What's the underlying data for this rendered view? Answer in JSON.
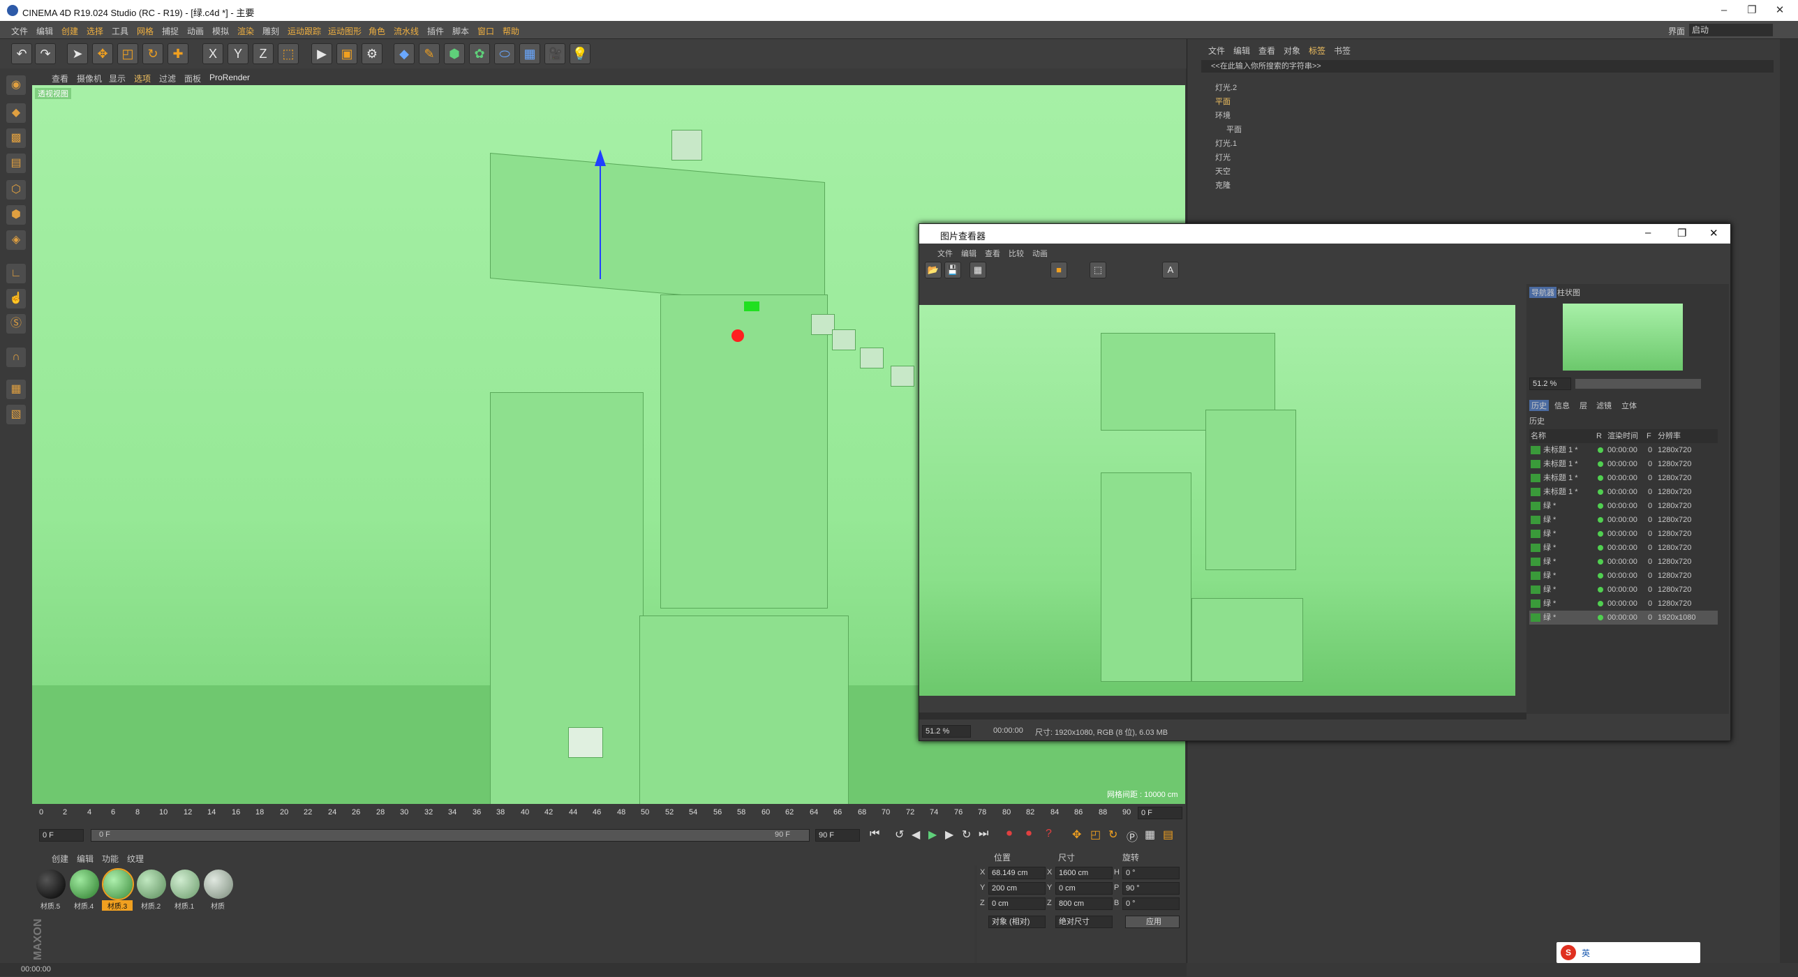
{
  "app": {
    "title": "CINEMA 4D R19.024 Studio (RC - R19) - [绿.c4d *] - 主要",
    "layout_label": "界面",
    "layout_value": "启动"
  },
  "menu": [
    "文件",
    "编辑",
    "创建",
    "选择",
    "工具",
    "网格",
    "捕捉",
    "动画",
    "模拟",
    "渲染",
    "雕刻",
    "运动跟踪",
    "运动图形",
    "角色",
    "流水线",
    "插件",
    "脚本",
    "窗口",
    "帮助"
  ],
  "toolbar": {
    "icons": [
      "undo",
      "redo",
      "select",
      "move",
      "scale",
      "rotate",
      "add",
      "x-axis",
      "y-axis",
      "z-axis",
      "coords",
      "render-view",
      "render",
      "render-settings",
      "cube",
      "pen",
      "subdiv",
      "array",
      "deformer",
      "scene",
      "camera",
      "light"
    ],
    "axis_x": "X",
    "axis_y": "Y",
    "axis_z": "Z"
  },
  "viewport": {
    "menu": [
      "查看",
      "摄像机",
      "显示",
      "选项",
      "过滤",
      "面板",
      "ProRender"
    ],
    "label": "透视视图",
    "grid_info": "网格间距 : 10000 cm"
  },
  "timeline": {
    "ticks": [
      "0",
      "2",
      "4",
      "6",
      "8",
      "10",
      "12",
      "14",
      "16",
      "18",
      "20",
      "22",
      "24",
      "26",
      "28",
      "30",
      "32",
      "34",
      "36",
      "38",
      "40",
      "42",
      "44",
      "46",
      "48",
      "50",
      "52",
      "54",
      "56",
      "58",
      "60",
      "62",
      "64",
      "66",
      "68",
      "70",
      "72",
      "74",
      "76",
      "78",
      "80",
      "82",
      "84",
      "86",
      "88",
      "90"
    ],
    "current_frame": "0 F",
    "start": "0 F",
    "end": "90 F",
    "range_end": "90 F",
    "frame_field": "0 F"
  },
  "materials": {
    "menu": [
      "创建",
      "编辑",
      "功能",
      "纹理"
    ],
    "items": [
      {
        "name": "材质.5",
        "color": "#111111"
      },
      {
        "name": "材质.4",
        "color": "#4aa84a"
      },
      {
        "name": "材质.3",
        "color": "#5cbc5c"
      },
      {
        "name": "材质.2",
        "color": "#7ab87a"
      },
      {
        "name": "材质.1",
        "color": "#8aba8a"
      },
      {
        "name": "材质",
        "color": "#9aa89a"
      }
    ]
  },
  "coords": {
    "headers": [
      "位置",
      "尺寸",
      "旋转"
    ],
    "rows": [
      {
        "axis": "X",
        "pos": "68.149 cm",
        "size_axis": "X",
        "size": "1600 cm",
        "rot_axis": "H",
        "rot": "0 °"
      },
      {
        "axis": "Y",
        "pos": "200 cm",
        "size_axis": "Y",
        "size": "0 cm",
        "rot_axis": "P",
        "rot": "90 °"
      },
      {
        "axis": "Z",
        "pos": "0 cm",
        "size_axis": "Z",
        "size": "800 cm",
        "rot_axis": "B",
        "rot": "0 °"
      }
    ],
    "mode1": "对象 (相对)",
    "mode2": "绝对尺寸",
    "apply": "应用"
  },
  "status": {
    "time": "00:00:00"
  },
  "objmgr": {
    "menu": [
      "文件",
      "编辑",
      "查看",
      "对象",
      "标签",
      "书签"
    ],
    "search": "<<在此输入你所搜索的字符串>>",
    "objects": [
      "灯光.2",
      "平面",
      "环境",
      "平面",
      "灯光.1",
      "灯光",
      "天空",
      "克隆"
    ]
  },
  "picviewer": {
    "title": "图片查看器",
    "menu": [
      "文件",
      "编辑",
      "查看",
      "比较",
      "动画"
    ],
    "tabs": [
      "导航器",
      "柱状图"
    ],
    "zoom": "51.2 %",
    "subtabs": [
      "历史",
      "信息",
      "层",
      "滤镜",
      "立体"
    ],
    "history_label": "历史",
    "columns": [
      "名称",
      "R",
      "渲染时间",
      "F",
      "分辨率"
    ],
    "rows": [
      {
        "name": "未标题 1 *",
        "time": "00:00:00",
        "f": "0",
        "res": "1280x720"
      },
      {
        "name": "未标题 1 *",
        "time": "00:00:00",
        "f": "0",
        "res": "1280x720"
      },
      {
        "name": "未标题 1 *",
        "time": "00:00:00",
        "f": "0",
        "res": "1280x720"
      },
      {
        "name": "未标题 1 *",
        "time": "00:00:00",
        "f": "0",
        "res": "1280x720"
      },
      {
        "name": "绿 *",
        "time": "00:00:00",
        "f": "0",
        "res": "1280x720"
      },
      {
        "name": "绿 *",
        "time": "00:00:00",
        "f": "0",
        "res": "1280x720"
      },
      {
        "name": "绿 *",
        "time": "00:00:00",
        "f": "0",
        "res": "1280x720"
      },
      {
        "name": "绿 *",
        "time": "00:00:00",
        "f": "0",
        "res": "1280x720"
      },
      {
        "name": "绿 *",
        "time": "00:00:00",
        "f": "0",
        "res": "1280x720"
      },
      {
        "name": "绿 *",
        "time": "00:00:00",
        "f": "0",
        "res": "1280x720"
      },
      {
        "name": "绿 *",
        "time": "00:00:00",
        "f": "0",
        "res": "1280x720"
      },
      {
        "name": "绿 *",
        "time": "00:00:00",
        "f": "0",
        "res": "1280x720"
      },
      {
        "name": "绿 *",
        "time": "00:00:00",
        "f": "0",
        "res": "1920x1080"
      }
    ],
    "status_zoom": "51.2 %",
    "status_time": "00:00:00",
    "status_info": "尺寸: 1920x1080, RGB (8 位), 6.03 MB"
  },
  "ime": {
    "label": "英"
  }
}
